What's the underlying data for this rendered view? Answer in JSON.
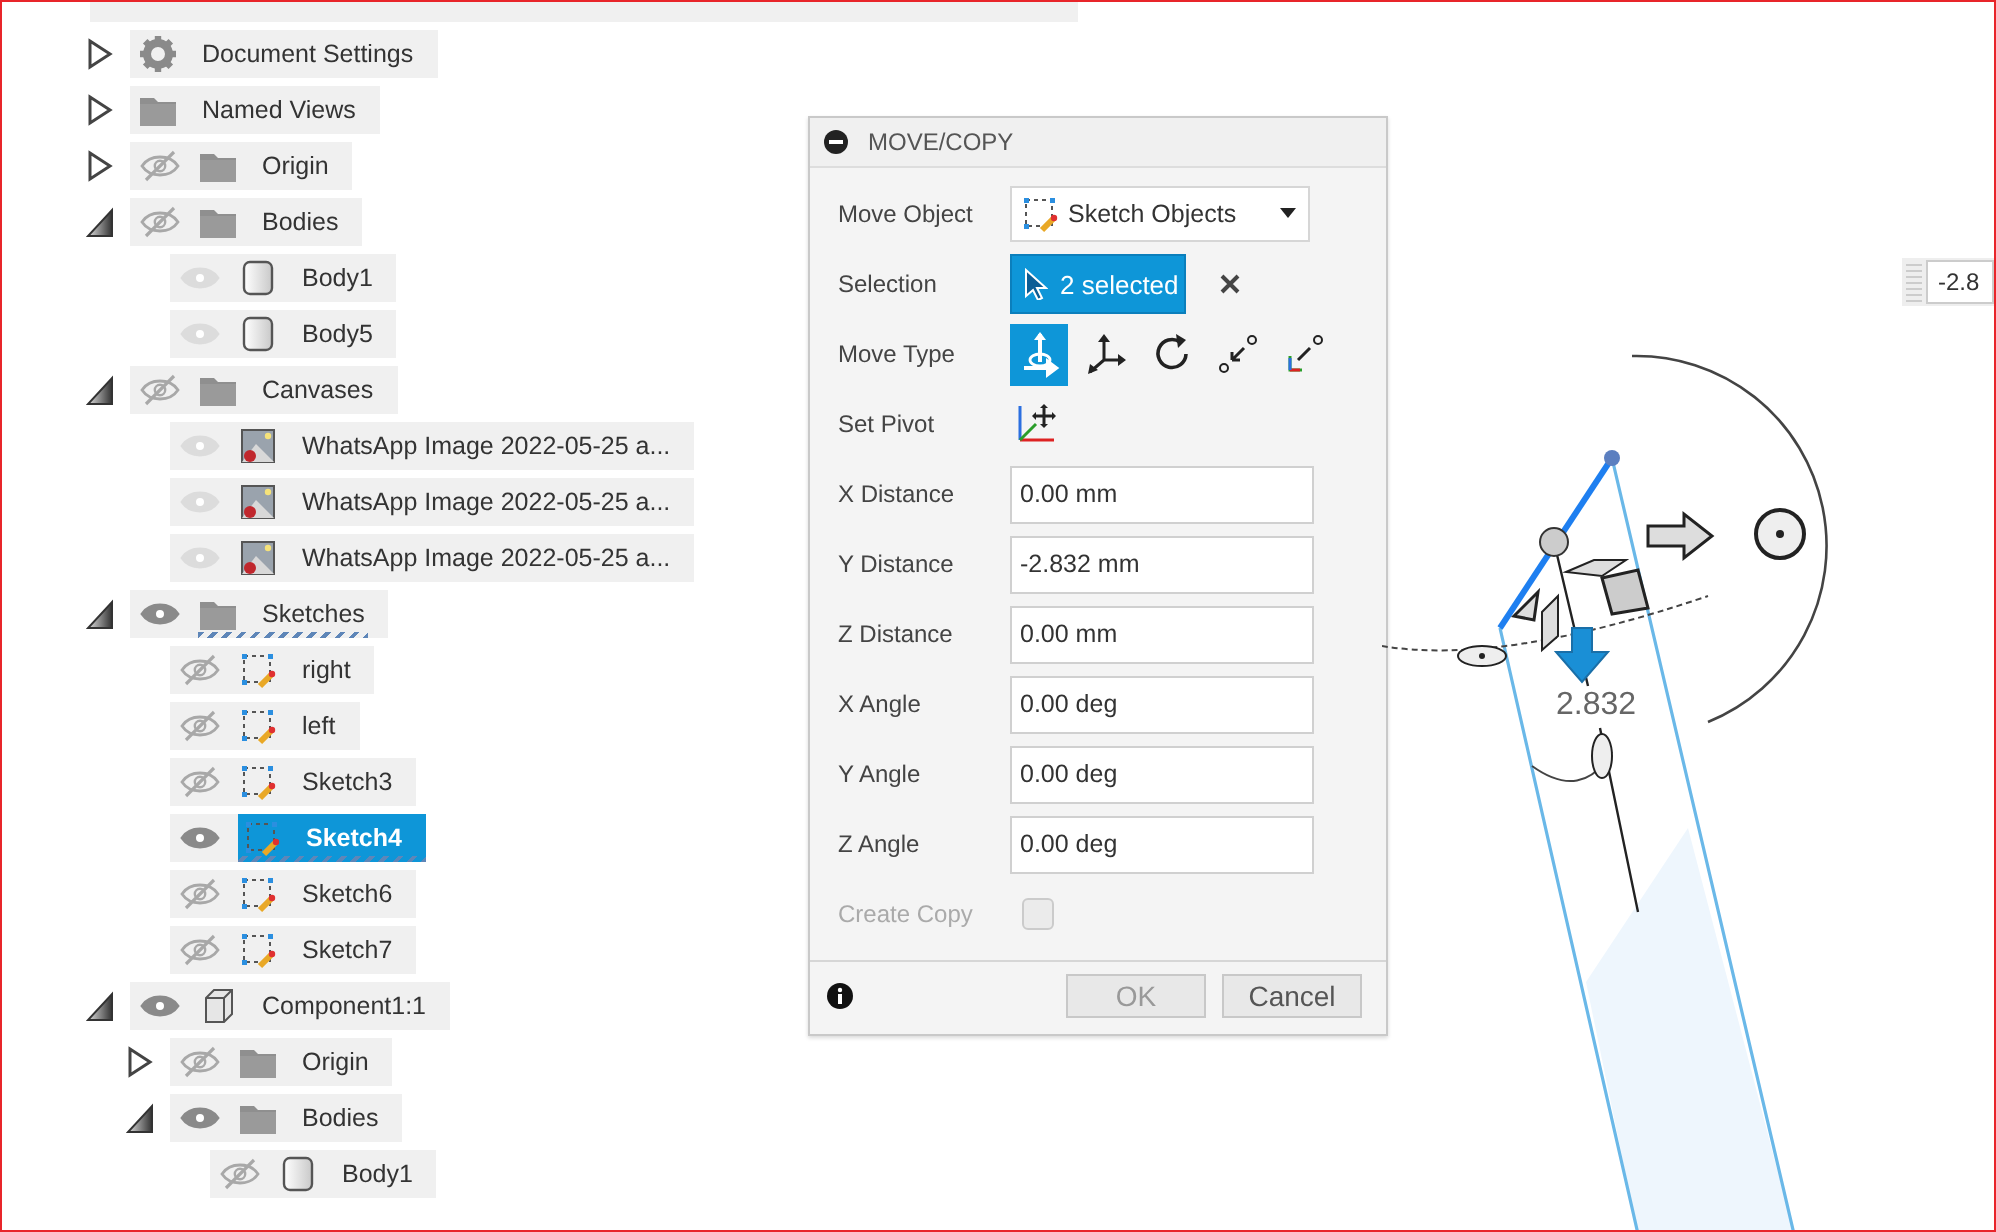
{
  "browser_tree": {
    "items": [
      {
        "label": "Document Settings",
        "kind": "gear",
        "expanded": false,
        "active": false,
        "selected": false
      },
      {
        "label": "Named Views",
        "kind": "folder",
        "expanded": false,
        "active": false,
        "selected": false
      },
      {
        "label": "Origin",
        "kind": "folder",
        "visible": false,
        "dimmed": false,
        "expanded": false,
        "active": false,
        "selected": false
      },
      {
        "label": "Bodies",
        "kind": "folder",
        "visible": false,
        "dimmed": false,
        "expanded": true,
        "active": false,
        "selected": false,
        "children": [
          {
            "label": "Body1",
            "kind": "body",
            "visible": true,
            "dimmed": true,
            "active": false,
            "selected": false
          },
          {
            "label": "Body5",
            "kind": "body",
            "visible": true,
            "dimmed": true,
            "active": false,
            "selected": false
          }
        ]
      },
      {
        "label": "Canvases",
        "kind": "folder",
        "visible": false,
        "dimmed": false,
        "expanded": true,
        "active": false,
        "selected": false,
        "children": [
          {
            "label": "WhatsApp Image 2022-05-25 a...",
            "kind": "canvas",
            "visible": true,
            "dimmed": true,
            "active": false,
            "selected": false
          },
          {
            "label": "WhatsApp Image 2022-05-25 a...",
            "kind": "canvas",
            "visible": true,
            "dimmed": true,
            "active": false,
            "selected": false
          },
          {
            "label": "WhatsApp Image 2022-05-25 a...",
            "kind": "canvas",
            "visible": true,
            "dimmed": true,
            "active": false,
            "selected": false
          }
        ]
      },
      {
        "label": "Sketches",
        "kind": "folder",
        "visible": true,
        "dimmed": false,
        "expanded": true,
        "active": true,
        "selected": false,
        "children": [
          {
            "label": "right",
            "kind": "sketch",
            "visible": false,
            "dimmed": false,
            "active": false,
            "selected": false
          },
          {
            "label": "left",
            "kind": "sketch",
            "visible": false,
            "dimmed": false,
            "active": false,
            "selected": false
          },
          {
            "label": "Sketch3",
            "kind": "sketch",
            "visible": false,
            "dimmed": false,
            "active": false,
            "selected": false
          },
          {
            "label": "Sketch4",
            "kind": "sketch",
            "visible": true,
            "dimmed": false,
            "active": true,
            "selected": true
          },
          {
            "label": "Sketch6",
            "kind": "sketch",
            "visible": false,
            "dimmed": false,
            "active": false,
            "selected": false
          },
          {
            "label": "Sketch7",
            "kind": "sketch",
            "visible": false,
            "dimmed": false,
            "active": false,
            "selected": false
          }
        ]
      },
      {
        "label": "Component1:1",
        "kind": "component",
        "visible": true,
        "dimmed": false,
        "expanded": true,
        "active": false,
        "selected": false,
        "children": [
          {
            "label": "Origin",
            "kind": "folder",
            "visible": false,
            "dimmed": false,
            "expanded": false,
            "active": false,
            "selected": false
          },
          {
            "label": "Bodies",
            "kind": "folder",
            "visible": true,
            "dimmed": false,
            "expanded": true,
            "active": false,
            "selected": false,
            "children": [
              {
                "label": "Body1",
                "kind": "body",
                "visible": false,
                "dimmed": false,
                "active": false,
                "selected": false
              }
            ]
          }
        ]
      }
    ]
  },
  "dialog": {
    "title": "MOVE/COPY",
    "rows": [
      {
        "kind": "dropdown",
        "label": "Move Object",
        "value": "Sketch Objects"
      },
      {
        "kind": "selection",
        "label": "Selection",
        "value": "2 selected"
      },
      {
        "kind": "icons",
        "label": "Move Type",
        "options": [
          {
            "selected": true
          },
          {
            "selected": false
          },
          {
            "selected": false
          },
          {
            "selected": false
          },
          {
            "selected": false
          }
        ]
      },
      {
        "kind": "pivot",
        "label": "Set Pivot"
      },
      {
        "kind": "field",
        "label": "X Distance",
        "value": "0.00 mm"
      },
      {
        "kind": "field",
        "label": "Y Distance",
        "value": "-2.832 mm"
      },
      {
        "kind": "field",
        "label": "Z Distance",
        "value": "0.00 mm"
      },
      {
        "kind": "field",
        "label": "X Angle",
        "value": "0.00 deg"
      },
      {
        "kind": "field",
        "label": "Y Angle",
        "value": "0.00 deg"
      },
      {
        "kind": "field",
        "label": "Z Angle",
        "value": "0.00 deg"
      },
      {
        "kind": "checkbox",
        "label": "Create Copy",
        "checked": false,
        "disabled": true
      }
    ],
    "buttons": [
      {
        "label": "OK",
        "disabled": true
      },
      {
        "label": "Cancel",
        "disabled": false
      }
    ]
  },
  "viewport": {
    "dimension_label": "2.832",
    "value_field": "-2.8"
  }
}
